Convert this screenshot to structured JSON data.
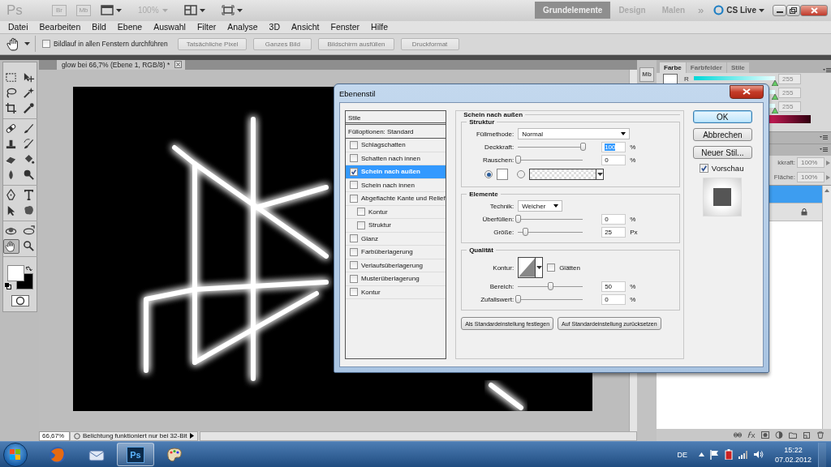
{
  "app_bar": {
    "logo": "Ps",
    "badges": [
      "Br",
      "Mb"
    ],
    "zoom": "100%",
    "workspaces": [
      {
        "label": "Grundelemente",
        "selected": true
      },
      {
        "label": "Design",
        "selected": false
      },
      {
        "label": "Malen",
        "selected": false
      }
    ],
    "more": "»",
    "cs_live": "CS Live"
  },
  "menu": [
    "Datei",
    "Bearbeiten",
    "Bild",
    "Ebene",
    "Auswahl",
    "Filter",
    "Analyse",
    "3D",
    "Ansicht",
    "Fenster",
    "Hilfe"
  ],
  "options_bar": {
    "scroll_all": {
      "label": "Bildlauf in allen Fenstern durchführen",
      "checked": false
    },
    "buttons": [
      "Tatsächliche Pixel",
      "Ganzes Bild",
      "Bildschirm ausfüllen",
      "Druckformat"
    ]
  },
  "tools": [
    {
      "kind": "marquee",
      "selected": false
    },
    {
      "kind": "move",
      "selected": false
    },
    {
      "kind": "lasso",
      "selected": false
    },
    {
      "kind": "wand",
      "selected": false
    },
    {
      "kind": "crop",
      "selected": false
    },
    {
      "kind": "eyedropper",
      "selected": false
    },
    {
      "kind": "healing",
      "selected": false
    },
    {
      "kind": "brush",
      "selected": false
    },
    {
      "kind": "stamp",
      "selected": false
    },
    {
      "kind": "history",
      "selected": false
    },
    {
      "kind": "eraser",
      "selected": false
    },
    {
      "kind": "bucket",
      "selected": false
    },
    {
      "kind": "blur",
      "selected": false
    },
    {
      "kind": "dodge",
      "selected": false
    },
    {
      "kind": "pen",
      "selected": false
    },
    {
      "kind": "type",
      "selected": false
    },
    {
      "kind": "select",
      "selected": false
    },
    {
      "kind": "shape",
      "selected": false
    },
    {
      "kind": "rotate3d",
      "selected": false
    },
    {
      "kind": "camera3d",
      "selected": false
    },
    {
      "kind": "hand",
      "selected": true
    },
    {
      "kind": "zoom",
      "selected": false
    }
  ],
  "document": {
    "tab": "glow bei 66,7% (Ebene 1, RGB/8) *",
    "zoom": "66,67%",
    "status": "Belichtung funktioniert nur bei 32-Bit"
  },
  "panels": {
    "dock_badge": "Mb",
    "tabs": [
      {
        "label": "Farbe",
        "selected": true
      },
      {
        "label": "Farbfelder",
        "selected": false
      },
      {
        "label": "Stile",
        "selected": false
      }
    ],
    "channels": [
      {
        "label": "R",
        "value": "255",
        "level": 1
      },
      {
        "value": "255",
        "level": 1
      },
      {
        "value": "255",
        "level": 1
      }
    ],
    "layers": {
      "opacity_label": "kkraft:",
      "opacity": "100%",
      "fill_label": "Fläche:",
      "fill": "100%",
      "rows": [
        {
          "selected": true,
          "locked": false
        },
        {
          "selected": false,
          "locked": true
        }
      ]
    }
  },
  "dialog": {
    "title": "Ebenenstil",
    "styles_header": "Stile",
    "blend_options": "Fülloptionen: Standard",
    "styles": [
      {
        "label": "Schlagschatten",
        "checked": false,
        "selected": false
      },
      {
        "label": "Schatten nach innen",
        "checked": false,
        "selected": false
      },
      {
        "label": "Schein nach außen",
        "checked": true,
        "selected": true
      },
      {
        "label": "Schein nach innen",
        "checked": false,
        "selected": false
      },
      {
        "label": "Abgeflachte Kante und Relief",
        "checked": false,
        "selected": false,
        "children": [
          {
            "label": "Kontur",
            "checked": false,
            "selected": false
          },
          {
            "label": "Struktur",
            "checked": false,
            "selected": false
          }
        ]
      },
      {
        "label": "Glanz",
        "checked": false,
        "selected": false
      },
      {
        "label": "Farbüberlagerung",
        "checked": false,
        "selected": false
      },
      {
        "label": "Verlaufsüberlagerung",
        "checked": false,
        "selected": false
      },
      {
        "label": "Musterüberlagerung",
        "checked": false,
        "selected": false
      },
      {
        "label": "Kontur",
        "checked": false,
        "selected": false
      }
    ],
    "section": "Schein nach außen",
    "groups": [
      {
        "title": "Struktur",
        "rows": [
          {
            "kind": "dropdown",
            "label": "Füllmethode:",
            "value": "Normal"
          },
          {
            "kind": "slider",
            "label": "Deckkraft:",
            "level": 1,
            "value": "100",
            "unit": "%",
            "text_selected": true
          },
          {
            "kind": "slider",
            "label": "Rauschen:",
            "level": 0,
            "value": "0",
            "unit": "%",
            "text_selected": false
          },
          {
            "kind": "fill",
            "options": [
              {
                "kind": "color",
                "selected": true
              },
              {
                "kind": "gradient",
                "selected": false
              }
            ]
          }
        ]
      },
      {
        "title": "Elemente",
        "rows": [
          {
            "kind": "select",
            "label": "Technik:",
            "value": "Weicher"
          },
          {
            "kind": "slider",
            "label": "Überfüllen:",
            "level": 0,
            "value": "0",
            "unit": "%",
            "text_selected": false
          },
          {
            "kind": "slider",
            "label": "Größe:",
            "level": 0.12,
            "value": "25",
            "unit": "Px",
            "text_selected": false
          }
        ]
      },
      {
        "title": "Qualität",
        "rows": [
          {
            "kind": "contour",
            "label": "Kontur:",
            "option": {
              "label": "Glätten",
              "checked": false
            }
          },
          {
            "kind": "slider",
            "label": "Bereich:",
            "level": 0.5,
            "value": "50",
            "unit": "%",
            "text_selected": false
          },
          {
            "kind": "slider",
            "label": "Zufallswert:",
            "level": 0,
            "value": "0",
            "unit": "%",
            "text_selected": false
          }
        ]
      }
    ],
    "footer_buttons": [
      "Als Standardeinstellung festlegen",
      "Auf Standardeinstellung zurücksetzen"
    ],
    "buttons": [
      {
        "label": "OK",
        "default": true
      },
      {
        "label": "Abbrechen",
        "default": false
      },
      {
        "label": "Neuer Stil...",
        "default": false
      }
    ],
    "preview": {
      "label": "Vorschau",
      "checked": true
    }
  },
  "taskbar": {
    "apps": [
      {
        "kind": "browser",
        "active": false
      },
      {
        "kind": "mail",
        "active": false
      },
      {
        "kind": "photoshop",
        "active": true,
        "label": "Ps"
      },
      {
        "kind": "paint",
        "active": false
      }
    ],
    "language": "DE",
    "time": "15:22",
    "date": "07.02.2012"
  }
}
